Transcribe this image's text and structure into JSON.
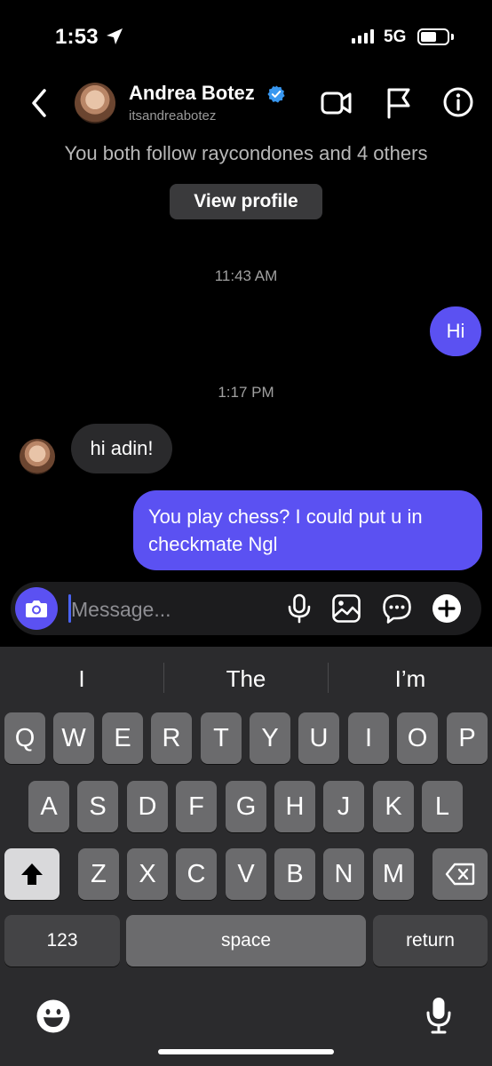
{
  "status_bar": {
    "time": "1:53",
    "network": "5G"
  },
  "header": {
    "name": "Andrea Botez",
    "handle": "itsandreabotez",
    "icons": [
      "back-chevron-icon",
      "verified-badge-icon",
      "video-call-icon",
      "flag-icon",
      "info-icon"
    ]
  },
  "profile_card": {
    "mutual_text": "You both follow raycondones and 4 others",
    "view_profile_label": "View profile"
  },
  "messages": [
    {
      "type": "timestamp",
      "text": "11:43 AM"
    },
    {
      "type": "outgoing",
      "text": "Hi"
    },
    {
      "type": "timestamp",
      "text": "1:17 PM"
    },
    {
      "type": "incoming",
      "text": "hi adin!"
    },
    {
      "type": "outgoing",
      "text": "You play chess? I could put u in checkmate Ngl"
    }
  ],
  "composer": {
    "placeholder": "Message...",
    "icons": [
      "camera-icon",
      "microphone-icon",
      "gallery-icon",
      "sticker-icon",
      "plus-icon"
    ]
  },
  "keyboard": {
    "suggestions": [
      "I",
      "The",
      "I’m"
    ],
    "row1": [
      "Q",
      "W",
      "E",
      "R",
      "T",
      "Y",
      "U",
      "I",
      "O",
      "P"
    ],
    "row2": [
      "A",
      "S",
      "D",
      "F",
      "G",
      "H",
      "J",
      "K",
      "L"
    ],
    "row3": [
      "Z",
      "X",
      "C",
      "V",
      "B",
      "N",
      "M"
    ],
    "numbers_label": "123",
    "space_label": "space",
    "return_label": "return"
  },
  "colors": {
    "accent": "#5b51f2",
    "background": "#000000",
    "incoming_bubble": "#2a2a2c",
    "verified": "#3897f0"
  }
}
